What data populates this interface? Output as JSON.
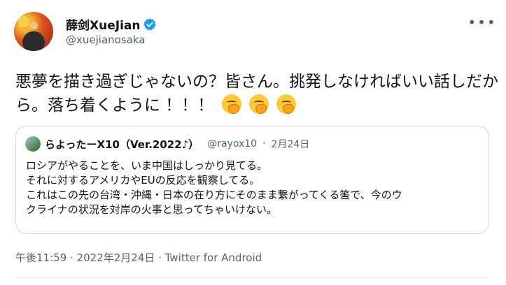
{
  "author": {
    "display_name": "薛剑XueJian",
    "handle": "@xuejianosaka",
    "verified": true
  },
  "tweet": {
    "text": "悪夢を描き過ぎじゃないの？皆さん。挑発しなければいい話しだから。落ち着くように ！！！",
    "emoji": [
      "face-with-hand-over-mouth",
      "face-with-hand-over-mouth",
      "face-with-hand-over-mouth"
    ]
  },
  "quoted_tweet": {
    "display_name": "らよったーX10（Ver.2022♪）",
    "handle": "@rayox10",
    "separator": "·",
    "date": "2月24日",
    "lines": [
      "ロシアがやることを、いま中国はしっかり見てる。",
      "それに対するアメリカやEUの反応を観察してる。",
      "これはこの先の台湾・沖縄・日本の在り方にそのまま繋がってくる筈で、今のウ",
      "クライナの状況を対岸の火事と思ってちゃいけない。"
    ]
  },
  "footer": {
    "time": "午後11:59",
    "separator": "·",
    "date": "2022年2月24日",
    "source": "Twitter for Android"
  },
  "more_icon": "more-horizontal-icon",
  "colors": {
    "verified_blue": "#1d9bf0",
    "secondary_text": "#536471",
    "border": "#cfd9de"
  }
}
